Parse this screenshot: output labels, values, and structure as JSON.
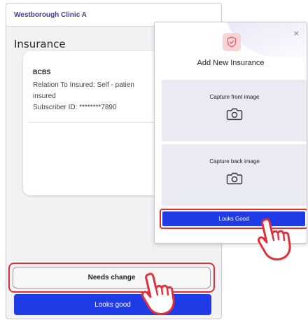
{
  "clinic": {
    "name": "Westborough Clinic A"
  },
  "insurance": {
    "title": "Insurance",
    "card": {
      "name": "BCBS",
      "relation_line1": "Relation To Insured: Self - patien",
      "relation_line2": "insured",
      "subscriber": "Subscriber ID: ********7890"
    },
    "needs_change_label": "Needs change",
    "looks_good_label": "Looks good"
  },
  "modal": {
    "close_glyph": "×",
    "title": "Add New Insurance",
    "front_label": "Capture front image",
    "back_label": "Capture back image",
    "looks_good_label": "Looks Good"
  },
  "icons": {
    "modal_icon": "shield-check-icon",
    "capture_icon": "camera-icon",
    "pointer": "hand-pointer-icon"
  },
  "colors": {
    "primary": "#1f3be6",
    "highlight": "#d9303a",
    "clinic_text": "#4a3a9a",
    "modal_icon_bg": "#f7d5d7",
    "capture_bg": "#eaeaf3"
  }
}
